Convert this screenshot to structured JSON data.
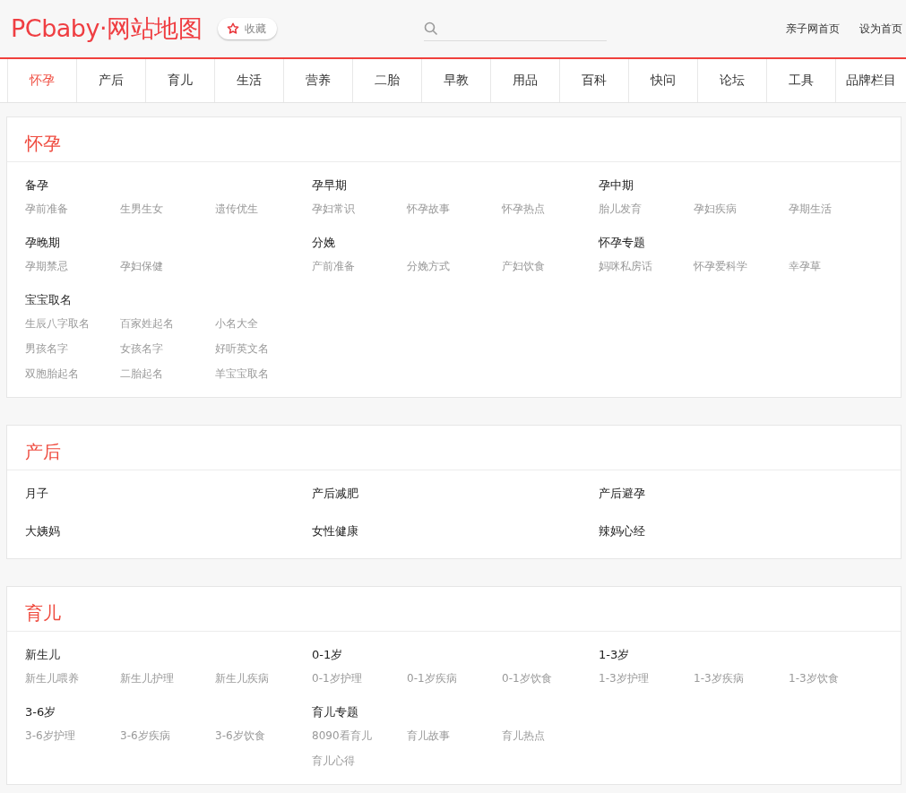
{
  "header": {
    "logo": "PCbaby·网站地图",
    "favorite_button": "收藏",
    "links": [
      "亲子网首页",
      "设为首页"
    ]
  },
  "nav": [
    {
      "label": "怀孕",
      "selected": true
    },
    {
      "label": "产后",
      "selected": false
    },
    {
      "label": "育儿",
      "selected": false
    },
    {
      "label": "生活",
      "selected": false
    },
    {
      "label": "营养",
      "selected": false
    },
    {
      "label": "二胎",
      "selected": false
    },
    {
      "label": "早教",
      "selected": false
    },
    {
      "label": "用品",
      "selected": false
    },
    {
      "label": "百科",
      "selected": false
    },
    {
      "label": "快问",
      "selected": false
    },
    {
      "label": "论坛",
      "selected": false
    },
    {
      "label": "工具",
      "selected": false
    },
    {
      "label": "品牌栏目",
      "selected": false
    }
  ],
  "sections": [
    {
      "title": "怀孕",
      "groups": [
        {
          "heading": "备孕",
          "links": [
            "孕前准备",
            "生男生女",
            "遗传优生"
          ]
        },
        {
          "heading": "孕早期",
          "links": [
            "孕妇常识",
            "怀孕故事",
            "怀孕热点"
          ]
        },
        {
          "heading": "孕中期",
          "links": [
            "胎儿发育",
            "孕妇疾病",
            "孕期生活"
          ]
        },
        {
          "heading": "孕晚期",
          "links": [
            "孕期禁忌",
            "孕妇保健"
          ]
        },
        {
          "heading": "分娩",
          "links": [
            "产前准备",
            "分娩方式",
            "产妇饮食"
          ]
        },
        {
          "heading": "怀孕专题",
          "links": [
            "妈咪私房话",
            "怀孕爱科学",
            "幸孕草"
          ]
        },
        {
          "heading": "宝宝取名",
          "links": [
            "生辰八字取名",
            "百家姓起名",
            "小名大全",
            "男孩名字",
            "女孩名字",
            "好听英文名",
            "双胞胎起名",
            "二胎起名",
            "羊宝宝取名"
          ]
        }
      ]
    },
    {
      "title": "产后",
      "groups": [
        {
          "heading": "月子"
        },
        {
          "heading": "产后减肥"
        },
        {
          "heading": "产后避孕"
        },
        {
          "heading": "大姨妈"
        },
        {
          "heading": "女性健康"
        },
        {
          "heading": "辣妈心经"
        }
      ]
    },
    {
      "title": "育儿",
      "groups": [
        {
          "heading": "新生儿",
          "links": [
            "新生儿喂养",
            "新生儿护理",
            "新生儿疾病"
          ]
        },
        {
          "heading": "0-1岁",
          "links": [
            "0-1岁护理",
            "0-1岁疾病",
            "0-1岁饮食"
          ]
        },
        {
          "heading": "1-3岁",
          "links": [
            "1-3岁护理",
            "1-3岁疾病",
            "1-3岁饮食"
          ]
        },
        {
          "heading": "3-6岁",
          "links": [
            "3-6岁护理",
            "3-6岁疾病",
            "3-6岁饮食"
          ]
        },
        {
          "heading": "育儿专题",
          "links": [
            "8090看育儿",
            "育儿故事",
            "育儿热点",
            "育儿心得"
          ]
        }
      ]
    }
  ]
}
